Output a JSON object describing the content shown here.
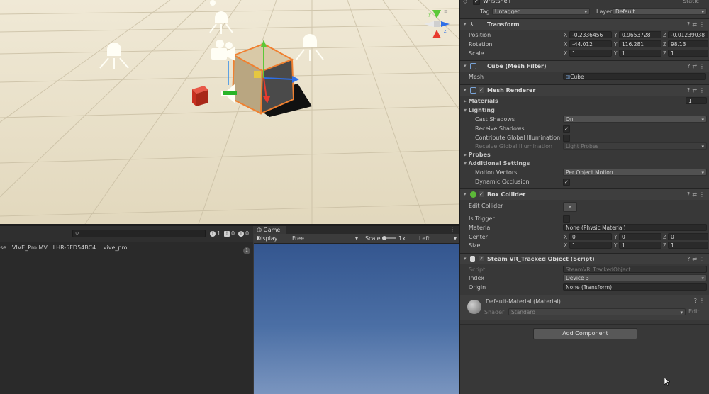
{
  "inspector": {
    "object_name": "Wristshell",
    "static_label": "Static",
    "tag_label": "Tag",
    "tag_value": "Untagged",
    "layer_label": "Layer",
    "layer_value": "Default",
    "transform": {
      "title": "Transform",
      "position_label": "Position",
      "position": {
        "x": "-0.2336456",
        "y": "0.9653728",
        "z": "-0.01239038"
      },
      "rotation_label": "Rotation",
      "rotation": {
        "x": "-44.012",
        "y": "116.281",
        "z": "98.13"
      },
      "scale_label": "Scale",
      "scale": {
        "x": "1",
        "y": "1",
        "z": "1"
      }
    },
    "mesh_filter": {
      "title": "Cube (Mesh Filter)",
      "mesh_label": "Mesh",
      "mesh_value": "Cube"
    },
    "mesh_renderer": {
      "title": "Mesh Renderer",
      "materials_label": "Materials",
      "materials_count": "1",
      "lighting_label": "Lighting",
      "cast_shadows_label": "Cast Shadows",
      "cast_shadows_value": "On",
      "receive_shadows_label": "Receive Shadows",
      "contribute_gi_label": "Contribute Global Illumination",
      "receive_gi_label": "Receive Global Illumination",
      "receive_gi_value": "Light Probes",
      "probes_label": "Probes",
      "additional_label": "Additional Settings",
      "motion_vectors_label": "Motion Vectors",
      "motion_vectors_value": "Per Object Motion",
      "dynamic_occlusion_label": "Dynamic Occlusion"
    },
    "box_collider": {
      "title": "Box Collider",
      "edit_collider_label": "Edit Collider",
      "is_trigger_label": "Is Trigger",
      "material_label": "Material",
      "material_value": "None (Physic Material)",
      "center_label": "Center",
      "center": {
        "x": "0",
        "y": "0",
        "z": "0"
      },
      "size_label": "Size",
      "size": {
        "x": "1",
        "y": "1",
        "z": "1"
      }
    },
    "tracked_object": {
      "title": "Steam VR_Tracked Object (Script)",
      "script_label": "Script",
      "script_value": "SteamVR_TrackedObject",
      "index_label": "Index",
      "index_value": "Device 3",
      "origin_label": "Origin",
      "origin_value": "None (Transform)"
    },
    "material": {
      "title": "Default-Material (Material)",
      "shader_label": "Shader",
      "shader_value": "Standard",
      "edit_label": "Edit..."
    },
    "add_component_label": "Add Component"
  },
  "console": {
    "search_placeholder": "",
    "search_icon": "search-icon",
    "error_count": "1",
    "warning_count": "0",
    "info_count": "0",
    "log_line": "se : VIVE_Pro MV : LHR-5FD54BC4 :: vive_pro",
    "collapse_count": "1"
  },
  "game": {
    "tab_label": "Game",
    "display_value": "Display 1",
    "aspect_value": "Free Aspect",
    "scale_label": "Scale",
    "scale_value": "1x",
    "eye_value": "Left Eye"
  },
  "colors": {
    "scene_floor": "#e9e0c9",
    "sky": "#4b6fa5",
    "panel": "#383838",
    "selection": "#f08030"
  }
}
